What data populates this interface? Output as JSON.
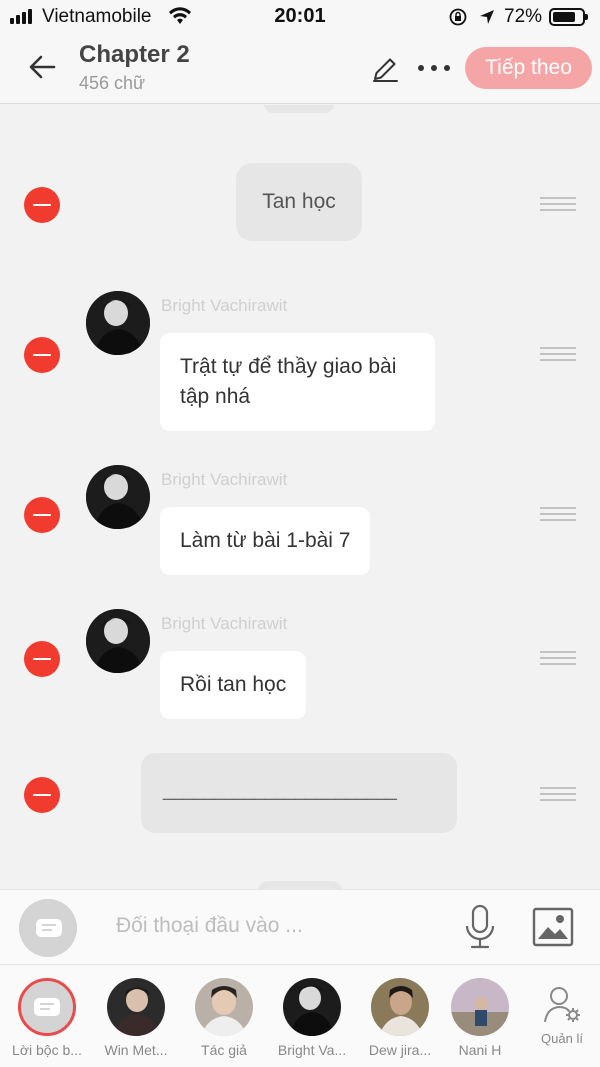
{
  "status_bar": {
    "carrier": "Vietnamobile",
    "time": "20:01",
    "battery": "72%"
  },
  "header": {
    "title": "Chapter 2",
    "word_count": "456 chữ",
    "next_label": "Tiếp theo",
    "accent_color": "#f5a5a6"
  },
  "chat": {
    "narration_1": "Tan học",
    "messages": [
      {
        "name": "Bright Vachirawit",
        "text": "Trật tự để thầy giao bài tập nhá"
      },
      {
        "name": "Bright Vachirawit",
        "text": "Làm từ bài 1-bài 7"
      },
      {
        "name": "Bright Vachirawit",
        "text": "Rồi tan học"
      }
    ],
    "narration_2": "_______________________"
  },
  "input": {
    "placeholder": "Đối thoại đầu vào ..."
  },
  "characters": [
    {
      "name": "Lời bộc b...",
      "icon": "narration-icon"
    },
    {
      "name": "Win Met..."
    },
    {
      "name": "Tác giả"
    },
    {
      "name": "Bright Va..."
    },
    {
      "name": "Dew jira..."
    },
    {
      "name": "Nani H"
    }
  ],
  "manage_label": "Quản lí",
  "colors": {
    "delete": "#f23b2f",
    "background": "#f2f2f2"
  }
}
